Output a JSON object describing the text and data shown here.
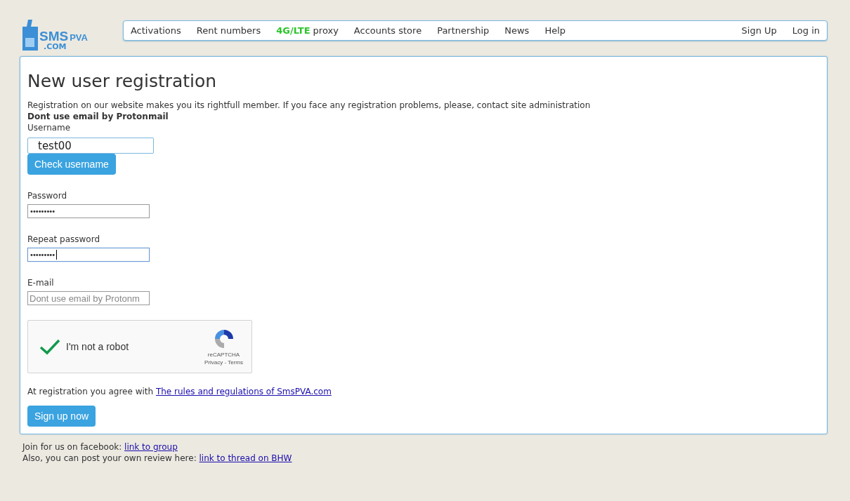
{
  "logo": {
    "main": "SMS",
    "accent": "PVA",
    "domain": ".COM"
  },
  "nav": {
    "left": [
      {
        "label": "Activations"
      },
      {
        "label": "Rent numbers"
      },
      {
        "highlight": "4G/LTE",
        "label": "proxy"
      },
      {
        "label": "Accounts store"
      },
      {
        "label": "Partnership"
      },
      {
        "label": "News"
      },
      {
        "label": "Help"
      }
    ],
    "right": [
      {
        "label": "Sign Up"
      },
      {
        "label": "Log in"
      }
    ]
  },
  "form": {
    "title": "New user registration",
    "intro": "Registration on our website makes you its rightfull member. If you face any registration problems, please, contact site administration",
    "warning": "Dont use email by Protonmail",
    "username": {
      "label": "Username",
      "value": "test00"
    },
    "check_button": "Check username",
    "fields": [
      {
        "label": "Password",
        "value": "•••••••••",
        "focused": false
      },
      {
        "label": "Repeat password",
        "value": "•••••••••",
        "focused": true
      },
      {
        "label": "E-mail",
        "placeholder": "Dont use email by Protonm",
        "focused": false
      }
    ],
    "captcha": {
      "checked": true,
      "label": "I'm not a robot",
      "brand": "reCAPTCHA",
      "links": "Privacy - Terms"
    },
    "agree": {
      "text": "At registration you agree with ",
      "link": "The rules and regulations of SmsPVA.com"
    },
    "submit": "Sign up now"
  },
  "footer": [
    {
      "text": "Join for us on facebook: ",
      "link": "link to group"
    },
    {
      "text": "Also, you can post your own review here: ",
      "link": "link to thread on BHW"
    }
  ]
}
